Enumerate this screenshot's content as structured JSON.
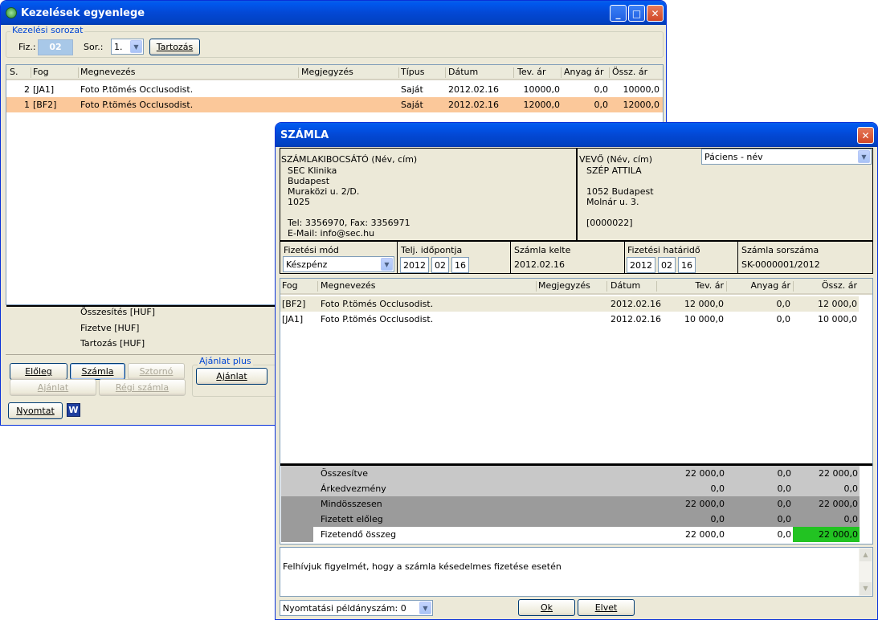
{
  "win1": {
    "title": "Kezelések egyenlege",
    "group_caption": "Kezelési sorozat",
    "fiz_label": "Fiz.:",
    "fiz_value": "02",
    "sor_label": "Sor.:",
    "sor_value": "1.",
    "tartozas_btn": "Tartozás",
    "columns": [
      "S.",
      "Fog",
      "Megnevezés",
      "Megjegyzés",
      "Típus",
      "Dátum",
      "Tev. ár",
      "Anyag ár",
      "Össz. ár"
    ],
    "rows": [
      {
        "s": "2",
        "fog": "[JA1]",
        "name": "Foto P.tömés Occlusodist.",
        "note": "",
        "type": "Saját",
        "date": "2012.02.16",
        "tev": "10000,0",
        "anyag": "0,0",
        "ossz": "10000,0"
      },
      {
        "s": "1",
        "fog": "[BF2]",
        "name": "Foto P.tömés Occlusodist.",
        "note": "",
        "type": "Saját",
        "date": "2012.02.16",
        "tev": "12000,0",
        "anyag": "0,0",
        "ossz": "12000,0"
      }
    ],
    "summary": [
      "Összesítés [HUF]",
      "Fizetve [HUF]",
      "Tartozás [HUF]"
    ],
    "btn_eloleg": "Előleg",
    "btn_szamla": "Számla",
    "btn_sztorno": "Sztornó",
    "btn_ajanlat": "Ajánlat",
    "btn_regi": "Régi számla",
    "ajanlat_plus_caption": "Ajánlat plus",
    "btn_ajanlat2": "Ajánlat",
    "btn_nyomtat": "Nyomtat",
    "word_icon": "W"
  },
  "win2": {
    "title": "SZÁMLA",
    "issuer": {
      "heading": "SZÁMLAKIBOCSÁTÓ (Név, cím)",
      "name": "SEC Klinika",
      "city": "Budapest",
      "street": "Muraközi u. 2/D.",
      "zip": "1025",
      "tel": "Tel: 3356970, Fax: 3356971",
      "email": "E-Mail: info@sec.hu"
    },
    "buyer": {
      "heading": "VEVŐ (Név, cím)",
      "name": "SZÉP ATTILA",
      "city": "1052 Budapest",
      "street": "Molnár u. 3.",
      "id": "[0000022]",
      "select": "Páciens - név"
    },
    "fields": {
      "fizmod_label": "Fizetési mód",
      "fizmod_value": "Készpénz",
      "telj_label": "Telj. időpontja",
      "telj": [
        "2012",
        "02",
        "16"
      ],
      "kelte_label": "Számla kelte",
      "kelte_value": "2012.02.16",
      "hatarido_label": "Fizetési határidő",
      "hatarido": [
        "2012",
        "02",
        "16"
      ],
      "sorszam_label": "Számla sorszáma",
      "sorszam_value": "SK-0000001/2012"
    },
    "columns": [
      "Fog",
      "Megnevezés",
      "Megjegyzés",
      "Dátum",
      "Tev. ár",
      "Anyag ár",
      "Össz. ár"
    ],
    "rows": [
      {
        "fog": "[BF2]",
        "name": "Foto P.tömés Occlusodist.",
        "note": "",
        "date": "2012.02.16",
        "tev": "12 000,0",
        "anyag": "0,0",
        "ossz": "12 000,0"
      },
      {
        "fog": "[JA1]",
        "name": "Foto P.tömés Occlusodist.",
        "note": "",
        "date": "2012.02.16",
        "tev": "10 000,0",
        "anyag": "0,0",
        "ossz": "10 000,0"
      }
    ],
    "totals": [
      {
        "label": "Összesítve",
        "tev": "22 000,0",
        "anyag": "0,0",
        "ossz": "22 000,0"
      },
      {
        "label": "Árkedvezmény",
        "tev": "0,0",
        "anyag": "0,0",
        "ossz": "0,0"
      },
      {
        "label": "Mindösszesen",
        "tev": "22 000,0",
        "anyag": "0,0",
        "ossz": "22 000,0"
      },
      {
        "label": "Fizetett előleg",
        "tev": "0,0",
        "anyag": "0,0",
        "ossz": "0,0"
      },
      {
        "label": "Fizetendő összeg",
        "tev": "22 000,0",
        "anyag": "0,0",
        "ossz": "22 000,0"
      }
    ],
    "note_text": "Felhívjuk figyelmét, hogy a számla késedelmes fizetése esetén",
    "copies": "Nyomtatási példányszám: 0",
    "ok": "Ok",
    "elvet": "Elvet"
  },
  "colors": {
    "selected_row": "#fbc89a",
    "pay_highlight": "#22c322",
    "title_blue": "#0348d4"
  }
}
